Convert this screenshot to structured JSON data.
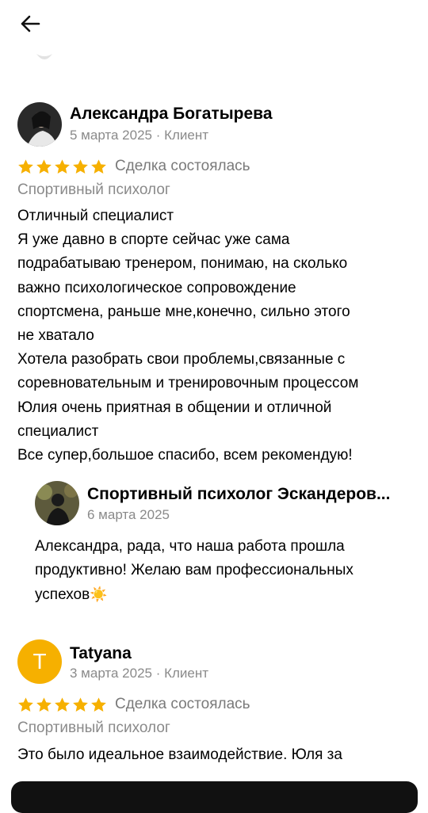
{
  "colors": {
    "star": "#f6b000",
    "meta": "#8a8a8a",
    "avatar_t": "#f6b000"
  },
  "icons": {
    "back": "arrow-left-icon",
    "star": "star-icon",
    "sun": "sun-emoji"
  },
  "reviews": [
    {
      "author": "Александра Богатырева",
      "date": "5 марта 2025",
      "role": "Клиент",
      "rating": 5,
      "deal": "Сделка состоялась",
      "service": "Спортивный психолог",
      "text_lines": [
        "Отличный специалист",
        "Я уже давно в спорте сейчас уже сама",
        "подрабатываю тренером, понимаю, на сколько",
        "важно психологическое сопровождение",
        "спортсмена, раньше мне,конечно, сильно этого",
        "не хватало",
        "Хотела разобрать свои проблемы,связанные с",
        "соревновательным и тренировочным процессом",
        "Юлия очень приятная в общении и отличной",
        "специалист",
        "Все супер,большое спасибо, всем рекомендую!"
      ],
      "reply": {
        "author": "Спортивный психолог Эскандеров...",
        "date": "6 марта 2025",
        "text_lines": [
          "Александра, рада, что наша работа прошла",
          "продуктивно! Желаю вам профессиональных",
          "успехов"
        ],
        "emoji": "☀️"
      }
    },
    {
      "author": "Tatyana",
      "avatar_letter": "T",
      "date": "3 марта 2025",
      "role": "Клиент",
      "rating": 5,
      "deal": "Сделка состоялась",
      "service": "Спортивный психолог",
      "text_lines": [
        "Это было идеальное взаимодействие. Юля за"
      ]
    }
  ]
}
